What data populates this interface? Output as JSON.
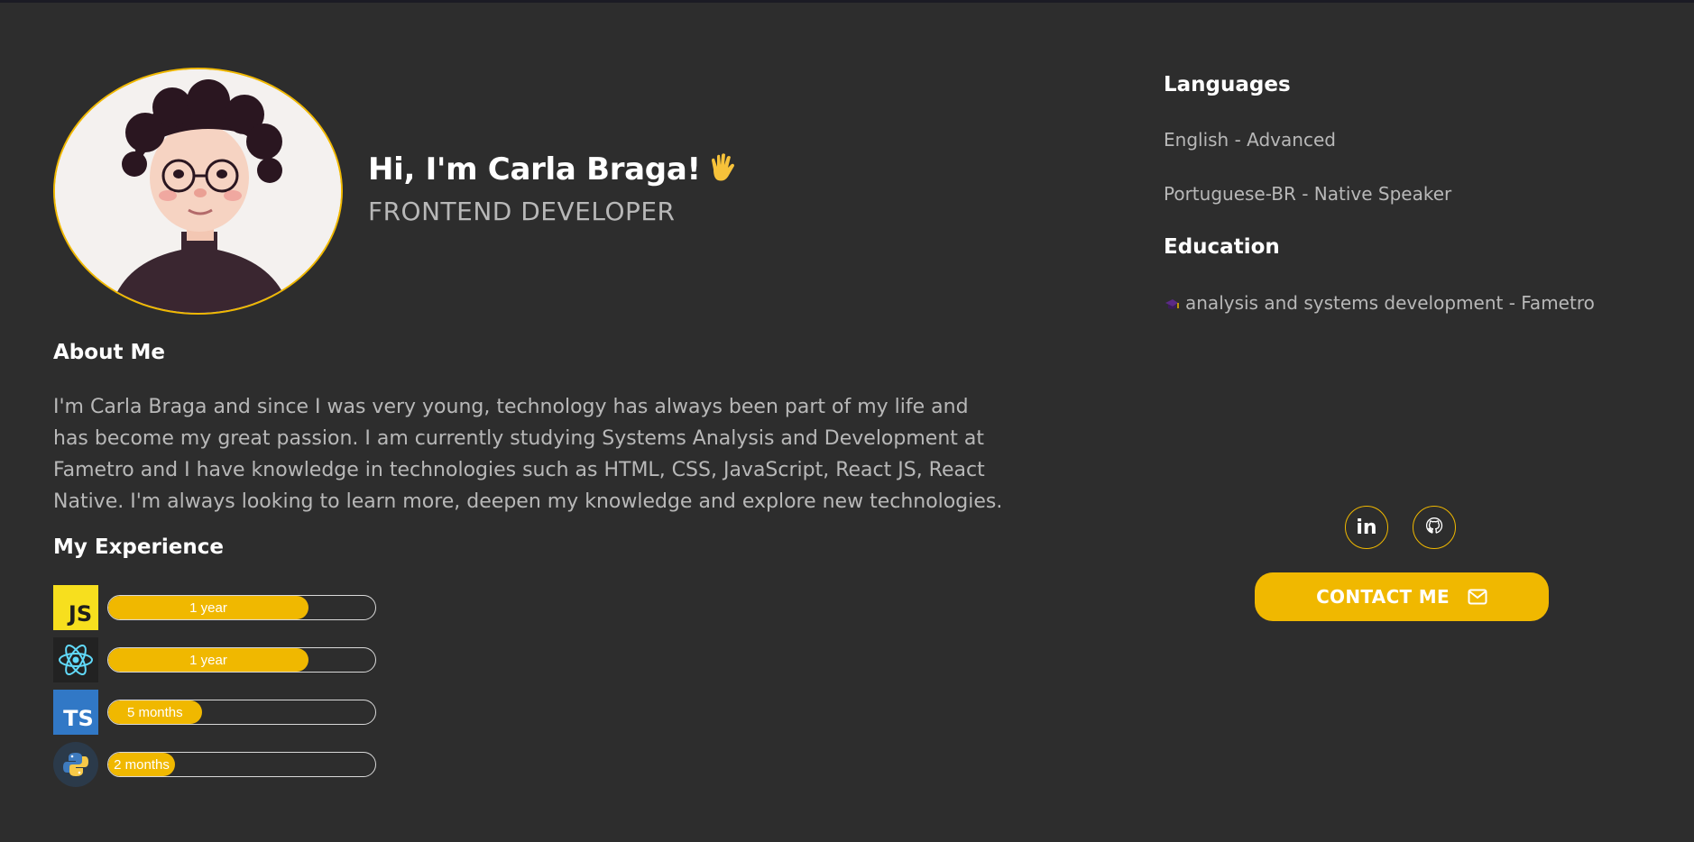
{
  "hero": {
    "greeting": "Hi, I'm Carla Braga!",
    "role": "FRONTEND DEVELOPER"
  },
  "about": {
    "title": "About Me",
    "text": "I'm Carla Braga and since I was very young, technology has always been part of my life and has become my great passion. I am currently studying Systems Analysis and Development at Fametro and I have knowledge in technologies such as HTML, CSS, JavaScript, React JS, React Native. I'm always looking to learn more, deepen my knowledge and explore new technologies."
  },
  "experience": {
    "title": "My Experience",
    "skills": [
      {
        "logo": "JS",
        "icon": "javascript-icon",
        "label": "1 year",
        "progress": 0.75
      },
      {
        "logo": "",
        "icon": "react-icon",
        "label": "1 year",
        "progress": 0.75
      },
      {
        "logo": "TS",
        "icon": "typescript-icon",
        "label": "5 months",
        "progress": 0.35
      },
      {
        "logo": "",
        "icon": "python-icon",
        "label": "2 months",
        "progress": 0.25
      }
    ]
  },
  "languages": {
    "title": "Languages",
    "items": [
      "English - Advanced",
      "Portuguese-BR - Native Speaker"
    ]
  },
  "education": {
    "title": "Education",
    "item": "analysis and systems development - Fametro"
  },
  "social": {
    "linkedin_text": "in",
    "icons": [
      "linkedin-icon",
      "github-icon"
    ]
  },
  "contact": {
    "label": "CONTACT ME"
  },
  "colors": {
    "background": "#2d2d2d",
    "accent": "#f0b800",
    "muted_text": "#b8b8b8"
  }
}
